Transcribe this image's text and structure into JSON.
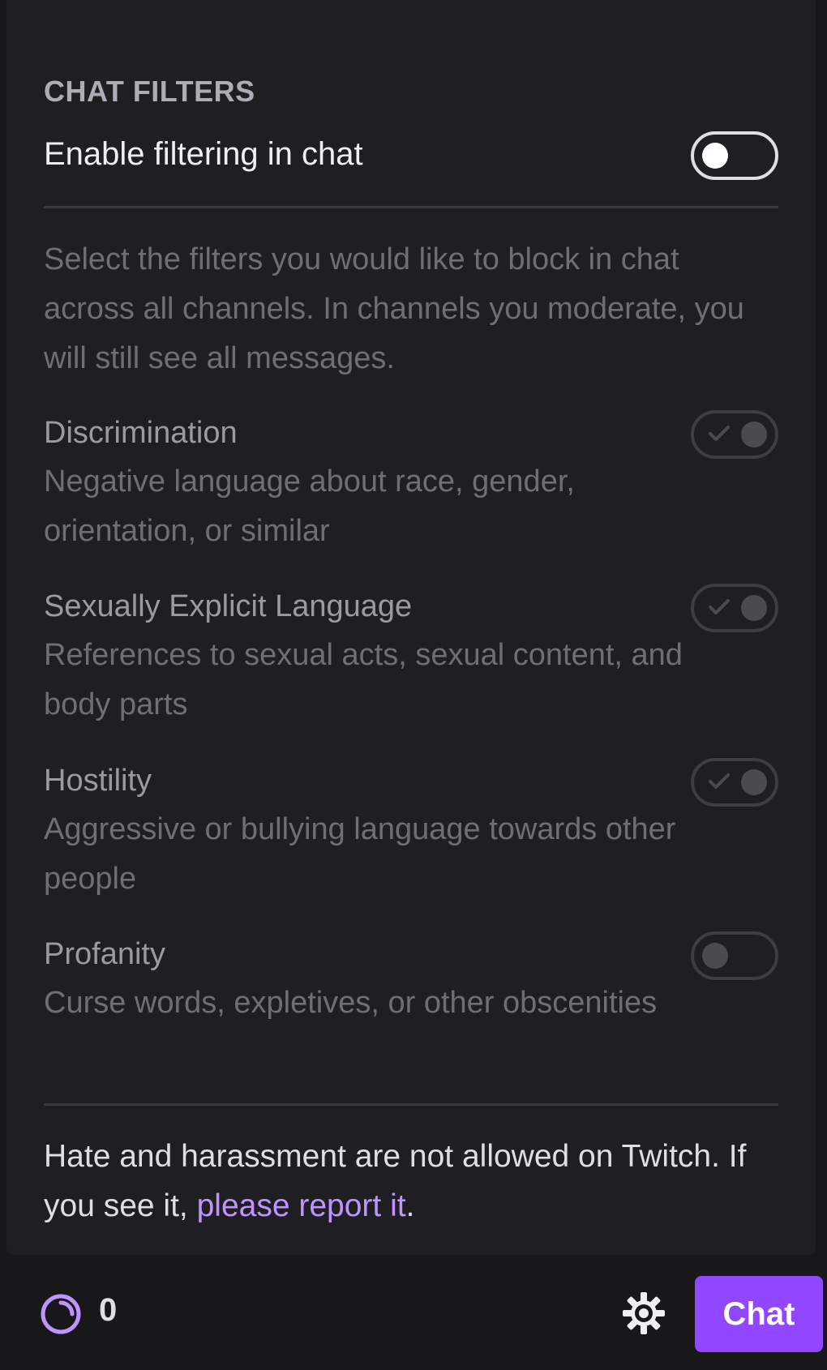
{
  "chat_filters": {
    "section_title": "CHAT FILTERS",
    "enable_label": "Enable filtering in chat",
    "enable_state": "off",
    "intro_text": "Select the filters you would like to block in chat across all channels. In channels you moderate, you will still see all messages.",
    "filters": [
      {
        "title": "Discrimination",
        "description": "Negative language about race, gender, orientation, or similar",
        "state": "checked"
      },
      {
        "title": "Sexually Explicit Language",
        "description": "References to sexual acts, sexual content, and body parts",
        "state": "checked"
      },
      {
        "title": "Hostility",
        "description": "Aggressive or bullying language towards other people",
        "state": "checked"
      },
      {
        "title": "Profanity",
        "description": "Curse words, expletives, or other obscenities",
        "state": "unchecked"
      }
    ],
    "footer_prefix": "Hate and harassment are not allowed on Twitch. If you see it, ",
    "footer_link": "please report it",
    "footer_suffix": "."
  },
  "bottom_bar": {
    "points_icon": "channel-points-icon",
    "points_count": "0",
    "settings_icon": "gear-icon",
    "chat_button_label": "Chat"
  },
  "colors": {
    "accent": "#9147ff",
    "link": "#bf94ff",
    "panel_background": "#1f1f23",
    "page_background": "#18181b"
  }
}
